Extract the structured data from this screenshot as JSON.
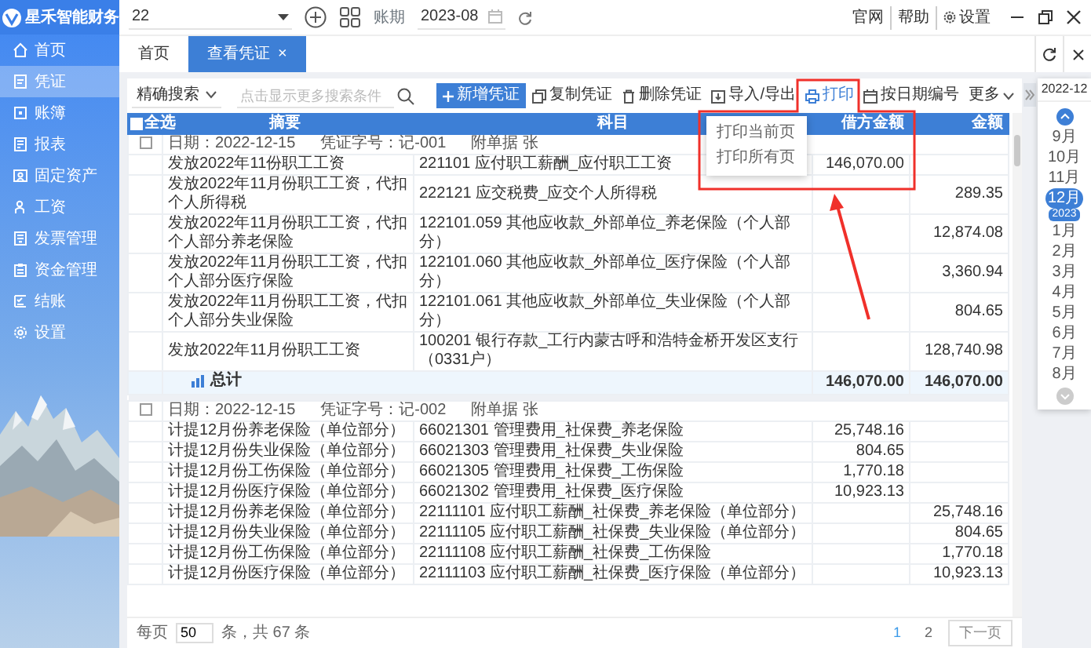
{
  "app": {
    "logo": "星禾智能财务"
  },
  "sidebar": {
    "items": [
      {
        "label": "首页",
        "selected": false
      },
      {
        "label": "凭证",
        "selected": true
      },
      {
        "label": "账簿",
        "selected": false
      },
      {
        "label": "报表",
        "selected": false
      },
      {
        "label": "固定资产",
        "selected": false
      },
      {
        "label": "工资",
        "selected": false
      },
      {
        "label": "发票管理",
        "selected": false
      },
      {
        "label": "资金管理",
        "selected": false
      },
      {
        "label": "结账",
        "selected": false
      },
      {
        "label": "设置",
        "selected": false
      }
    ]
  },
  "top_bar": {
    "account": "22",
    "period_label": "账期",
    "period": "2023-08",
    "links": [
      "官网",
      "帮助",
      "设置"
    ]
  },
  "tabs": [
    {
      "label": "首页",
      "selected": false
    },
    {
      "label": "查看凭证",
      "selected": true,
      "close": "×"
    }
  ],
  "toolbar": {
    "search_mode": "精确搜索",
    "search_placeholder": "点击显示更多搜索条件",
    "buttons": [
      {
        "label": "新增凭证",
        "kind": "primary",
        "expanded": false
      },
      {
        "label": "复制凭证",
        "kind": "plain",
        "expanded": false
      },
      {
        "label": "删除凭证",
        "kind": "plain",
        "expanded": false
      },
      {
        "label": "导入/导出",
        "kind": "plain",
        "expanded": false
      },
      {
        "label": "打印",
        "kind": "plain",
        "expanded": true,
        "menu": [
          "打印当前页",
          "打印所有页"
        ]
      },
      {
        "label": "按日期编号",
        "kind": "plain",
        "expanded": false
      },
      {
        "label": "更多",
        "kind": "dropdown",
        "expanded": false
      }
    ]
  },
  "table": {
    "select_all": "全选",
    "select_all_checked": false,
    "columns": [
      "摘要",
      "科目",
      "借方金额",
      "金额"
    ],
    "vouchers": [
      {
        "checked": false,
        "date": "日期：2022-12-15",
        "number": "凭证字号：记-001",
        "attachments": "附单据 张",
        "rows": [
          {
            "summary": "发放2022年11份职工工资",
            "account": "221101 应付职工薪酬_应付职工工资",
            "debit": "146,070.00"
          },
          {
            "summary": "发放2022年11月份职工工资，代扣个人所得税",
            "account": "222121 应交税费_应交个人所得税",
            "credit": "289.35"
          },
          {
            "summary": "发放2022年11月份职工工资，代扣个人部分养老保险",
            "account": "122101.059 其他应收款_外部单位_养老保险（个人部分）",
            "credit": "12,874.08"
          },
          {
            "summary": "发放2022年11月份职工工资，代扣个人部分医疗保险",
            "account": "122101.060 其他应收款_外部单位_医疗保险（个人部分）",
            "credit": "3,360.94"
          },
          {
            "summary": "发放2022年11月份职工工资，代扣个人部分失业保险",
            "account": "122101.061 其他应收款_外部单位_失业保险（个人部分）",
            "credit": "804.65"
          },
          {
            "summary": "发放2022年11月份职工工资",
            "account": "100201 银行存款_工行内蒙古呼和浩特金桥开发区支行（0331户）",
            "credit": "128,740.98"
          }
        ],
        "total": {
          "label": "总计",
          "debit": "146,070.00",
          "credit": "146,070.00"
        }
      },
      {
        "checked": false,
        "date": "日期：2022-12-15",
        "number": "凭证字号：记-002",
        "attachments": "附单据 张",
        "rows": [
          {
            "summary": "计提12月份养老保险（单位部分）",
            "account": "66021301 管理费用_社保费_养老保险",
            "debit": "25,748.16"
          },
          {
            "summary": "计提12月份失业保险（单位部分）",
            "account": "66021303 管理费用_社保费_失业保险",
            "debit": "804.65"
          },
          {
            "summary": "计提12月份工伤保险（单位部分）",
            "account": "66021305 管理费用_社保费_工伤保险",
            "debit": "1,770.18"
          },
          {
            "summary": "计提12月份医疗保险（单位部分）",
            "account": "66021302 管理费用_社保费_医疗保险",
            "debit": "10,923.13"
          },
          {
            "summary": "计提12月份养老保险（单位部分）",
            "account": "22111101 应付职工薪酬_社保费_养老保险（单位部分）",
            "credit": "25,748.16"
          },
          {
            "summary": "计提12月份失业保险（单位部分）",
            "account": "22111105 应付职工薪酬_社保费_失业保险（单位部分）",
            "credit": "804.65"
          },
          {
            "summary": "计提12月份工伤保险（单位部分）",
            "account": "22111108 应付职工薪酬_社保费_工伤保险",
            "credit": "1,770.18"
          },
          {
            "summary": "计提12月份医疗保险（单位部分）",
            "account": "22111103 应付职工薪酬_社保费_医疗保险（单位部分）",
            "credit": "10,923.13"
          }
        ]
      }
    ]
  },
  "pagination": {
    "per_page_label": "每页",
    "per_page": "50",
    "count_label": "条，共 67 条",
    "pages": [
      {
        "label": "1",
        "selected": true
      },
      {
        "label": "2",
        "selected": false
      }
    ],
    "next": "下一页"
  },
  "period_panel": {
    "title": "2022-12",
    "months": [
      {
        "label": "9月",
        "selected": false
      },
      {
        "label": "10月",
        "selected": false
      },
      {
        "label": "11月",
        "selected": false
      },
      {
        "label": "12月",
        "selected": true
      },
      {
        "label": "1月",
        "selected": false,
        "year": "2023"
      },
      {
        "label": "2月",
        "selected": false
      },
      {
        "label": "3月",
        "selected": false
      },
      {
        "label": "4月",
        "selected": false
      },
      {
        "label": "5月",
        "selected": false
      },
      {
        "label": "6月",
        "selected": false
      },
      {
        "label": "7月",
        "selected": false
      },
      {
        "label": "8月",
        "selected": false
      }
    ]
  }
}
